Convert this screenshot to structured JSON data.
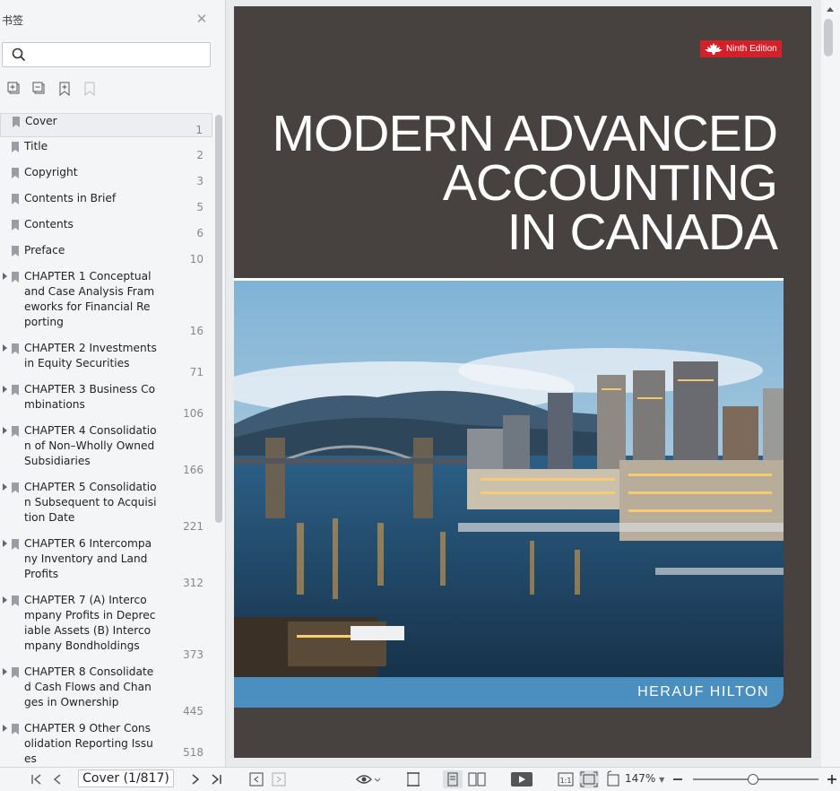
{
  "sidebar": {
    "title": "书签",
    "search": {
      "placeholder": "",
      "value": ""
    },
    "tools": [
      "expand-all-icon",
      "collapse-all-icon",
      "add-bookmark-icon",
      "remove-bookmark-icon"
    ],
    "bookmarks": [
      {
        "label": "Cover",
        "page": "1",
        "expandable": false,
        "selected": true
      },
      {
        "label": "Title",
        "page": "2",
        "expandable": false
      },
      {
        "label": "Copyright",
        "page": "3",
        "expandable": false
      },
      {
        "label": "Contents in Brief",
        "page": "5",
        "expandable": false
      },
      {
        "label": "Contents",
        "page": "6",
        "expandable": false
      },
      {
        "label": "Preface",
        "page": "10",
        "expandable": false
      },
      {
        "label": "CHAPTER 1 Conceptual and Case Analysis Frameworks for Financial Reporting",
        "page": "16",
        "expandable": true
      },
      {
        "label": "CHAPTER 2 Investments in Equity Securities",
        "page": "71",
        "expandable": true
      },
      {
        "label": "CHAPTER 3 Business Combinations",
        "page": "106",
        "expandable": true
      },
      {
        "label": "CHAPTER 4 Consolidation of Non–Wholly Owned Subsidiaries",
        "page": "166",
        "expandable": true
      },
      {
        "label": "CHAPTER 5 Consolidation Subsequent to Acquisition Date",
        "page": "221",
        "expandable": true
      },
      {
        "label": "CHAPTER 6 Intercompany Inventory and Land Profits",
        "page": "312",
        "expandable": true
      },
      {
        "label": "CHAPTER 7 (A) Intercompany Profits in Depreciable Assets (B) Intercompany Bondholdings",
        "page": "373",
        "expandable": true
      },
      {
        "label": "CHAPTER 8 Consolidated Cash Flows and Changes in Ownership",
        "page": "445",
        "expandable": true
      },
      {
        "label": "CHAPTER 9 Other Consolidation Reporting Issues",
        "page": "518",
        "expandable": true
      }
    ]
  },
  "cover": {
    "edition": "Ninth Edition",
    "title_lines": [
      "MODERN ADVANCED",
      "ACCOUNTING",
      "IN CANADA"
    ],
    "authors": "HERAUF   HILTON"
  },
  "toolbar": {
    "page_indicator": "Cover (1/817)",
    "zoom": "147%",
    "zoom_level": 0.47
  }
}
